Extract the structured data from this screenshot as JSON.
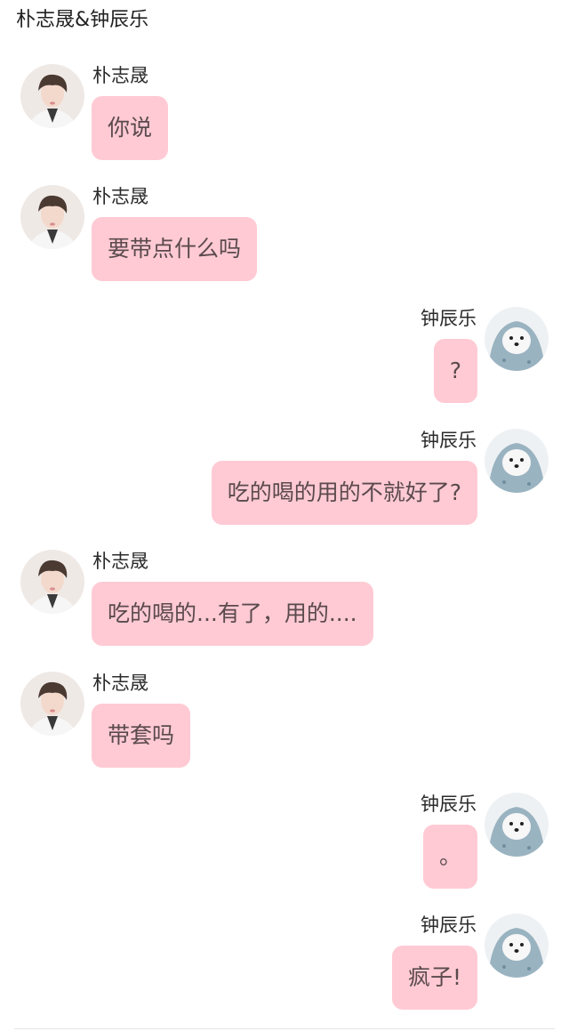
{
  "chat": {
    "title": "朴志晟&钟辰乐"
  },
  "messages": [
    {
      "sender": "朴志晟",
      "side": "left",
      "text": "你说",
      "avatar_icon": "boy-portrait"
    },
    {
      "sender": "朴志晟",
      "side": "left",
      "text": "要带点什么吗",
      "avatar_icon": "boy-portrait"
    },
    {
      "sender": "钟辰乐",
      "side": "right",
      "text": "?",
      "avatar_icon": "puppy-in-blue-hoodie"
    },
    {
      "sender": "钟辰乐",
      "side": "right",
      "text": "吃的喝的用的不就好了?",
      "avatar_icon": "puppy-in-blue-hoodie"
    },
    {
      "sender": "朴志晟",
      "side": "left",
      "text": "吃的喝的...有了，用的....",
      "avatar_icon": "boy-portrait"
    },
    {
      "sender": "朴志晟",
      "side": "left",
      "text": "带套吗",
      "avatar_icon": "boy-portrait"
    },
    {
      "sender": "钟辰乐",
      "side": "right",
      "text": "。",
      "avatar_icon": "puppy-in-blue-hoodie"
    },
    {
      "sender": "钟辰乐",
      "side": "right",
      "text": "疯子!",
      "avatar_icon": "puppy-in-blue-hoodie"
    }
  ],
  "colors": {
    "bubble": "#ffcad4",
    "bubble_text": "#5a4a4d",
    "background": "#ffffff"
  }
}
